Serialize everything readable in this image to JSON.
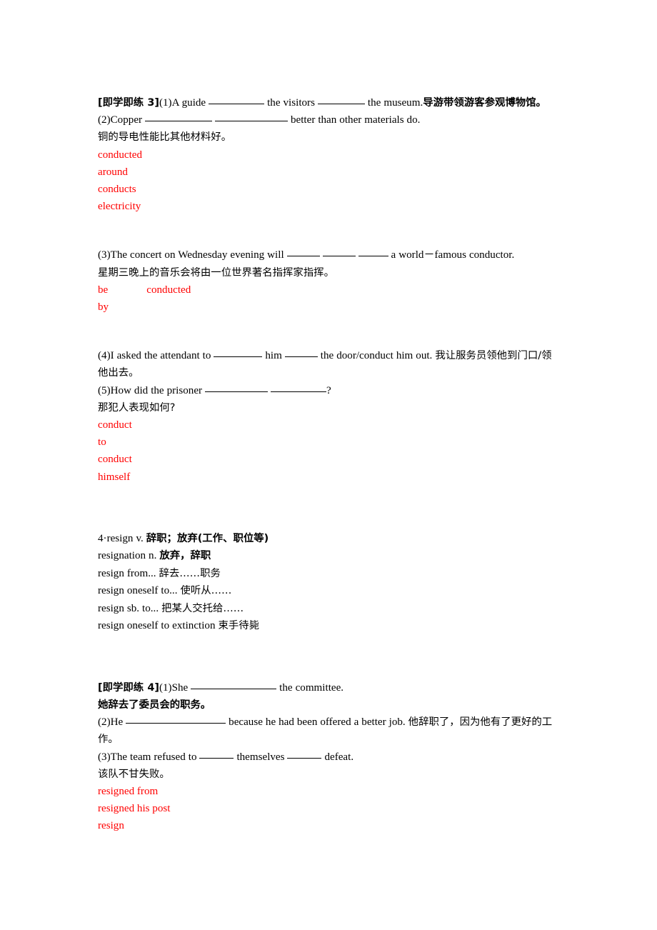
{
  "document": {
    "type": "english-grammar-worksheet",
    "answer_color": "#ff0000",
    "text_color": "#000000",
    "background": "#ffffff"
  },
  "exercise3": {
    "label": "[即学即练 3]",
    "q1": {
      "num": "(1)",
      "text_a": "A guide ",
      "blank1_width": 78,
      "text_b": " the visitors ",
      "blank2_width": 66,
      "text_c": " the museum.",
      "translation": "导游带领游客参观博物馆。"
    },
    "q2": {
      "num": "(2)",
      "text_a": "Copper ",
      "blank1_width": 94,
      "text_b": " ",
      "blank2_width": 102,
      "text_c": " better than other materials do.",
      "translation": "铜的导电性能比其他材料好。"
    },
    "answers_a": [
      "conducted",
      "around",
      "conducts",
      "electricity"
    ],
    "q3": {
      "num": "(3)",
      "text_a": "The concert on Wednesday evening will ",
      "blank1_width": 46,
      "text_b": " ",
      "blank2_width": 46,
      "text_c": " ",
      "blank3_width": 42,
      "text_d": " a world－famous conductor.",
      "translation": "星期三晚上的音乐会将由一位世界著名指挥家指挥。"
    },
    "answers_b_line1_col1": "be",
    "answers_b_line1_col2": "conducted",
    "answers_b_line2": "by",
    "q4": {
      "num": "(4)",
      "text_a": "I asked the attendant to ",
      "blank1_width": 68,
      "text_b": " him ",
      "blank2_width": 46,
      "text_c": " the door/conduct him out. ",
      "translation": "我让服务员领他到门口/领他出去。"
    },
    "q5": {
      "num": "(5)",
      "text_a": "How did the prisoner ",
      "blank1_width": 88,
      "text_b": " ",
      "blank2_width": 78,
      "text_c": "?",
      "translation": "那犯人表现如何?"
    },
    "answers_c": [
      "conduct",
      "to",
      "conduct",
      "himself"
    ]
  },
  "vocab4": {
    "headword_line": {
      "num": "4·",
      "word": "resign",
      "pos": " v. ",
      "meaning": "辞职；放弃(工作、职位等)"
    },
    "entries": [
      {
        "en": "resignation n. ",
        "cn": "放弃，辞职"
      },
      {
        "en": "resign from... ",
        "cn": "辞去……职务"
      },
      {
        "en": "resign oneself to... ",
        "cn": "使听从……"
      },
      {
        "en": "resign sb. to... ",
        "cn": "把某人交托给……"
      },
      {
        "en": "resign oneself to extinction  ",
        "cn": "束手待毙"
      }
    ]
  },
  "exercise4": {
    "label": "[即学即练 4]",
    "q1": {
      "num": "(1)",
      "text_a": "She ",
      "blank1_width": 120,
      "text_b": " the committee.",
      "translation": "她辞去了委员会的职务。"
    },
    "q2": {
      "num": "(2)",
      "text_a": "He ",
      "blank1_width": 140,
      "text_b": " because he had been offered a better job. ",
      "translation": "他辞职了，因为他有了更好的工作。"
    },
    "q3": {
      "num": "(3)",
      "text_a": "The team refused to ",
      "blank1_width": 48,
      "text_b": " themselves ",
      "blank2_width": 48,
      "text_c": " defeat.",
      "translation": "该队不甘失败。"
    },
    "answers": [
      "resigned from",
      "resigned his post",
      "resign"
    ]
  }
}
